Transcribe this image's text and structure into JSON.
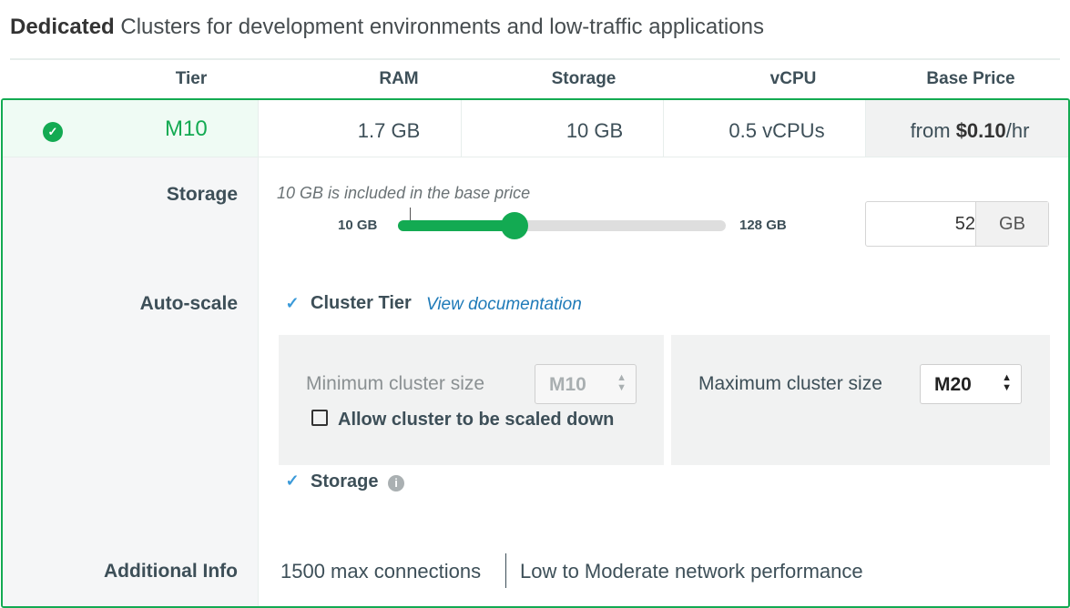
{
  "heading": {
    "bold": "Dedicated",
    "text": " Clusters for development environments and low-traffic applications"
  },
  "table_headers": [
    "Tier",
    "RAM",
    "Storage",
    "vCPU",
    "Base Price"
  ],
  "tier_row": {
    "tier": "M10",
    "ram": "1.7 GB",
    "storage": "10 GB",
    "vcpu": "0.5 vCPUs",
    "price_prefix": "from ",
    "price_value": "$0.10",
    "price_suffix": "/hr",
    "selected": true
  },
  "labels": {
    "storage": "Storage",
    "autoscale": "Auto-scale",
    "additional_info": "Additional Info"
  },
  "storage_slider": {
    "hint": "10 GB is included in the base price",
    "min_label": "10 GB",
    "max_label": "128 GB",
    "min_value": 10,
    "max_value": 128,
    "current_value": 52,
    "input_value": "52",
    "unit": "GB"
  },
  "autoscale": {
    "cluster_tier_label": "Cluster Tier",
    "cluster_tier_checked": true,
    "view_documentation": "View documentation",
    "min_cluster_label": "Minimum cluster size",
    "min_cluster_value": "M10",
    "allow_scale_down_label": "Allow cluster to be scaled down",
    "allow_scale_down_checked": false,
    "max_cluster_label": "Maximum cluster size",
    "max_cluster_value": "M20",
    "storage_label": "Storage",
    "storage_checked": true
  },
  "additional_info": {
    "connections": "1500 max connections",
    "network": "Low to Moderate network performance"
  },
  "colors": {
    "accent_green": "#13aa52",
    "link_blue": "#1e7ab8",
    "checkbox_blue": "#3b9ad9"
  }
}
